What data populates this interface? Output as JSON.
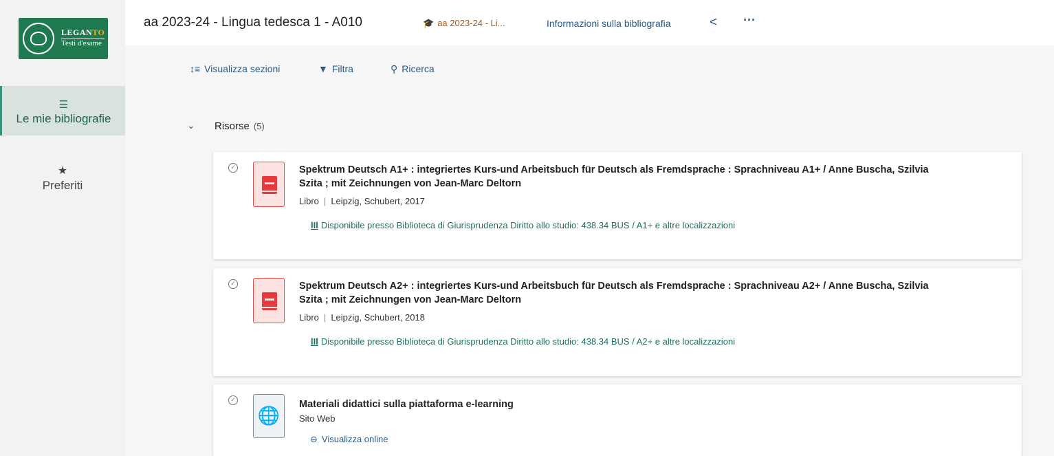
{
  "sidebar": {
    "logo_title_a": "LEGAN",
    "logo_title_b": "TO",
    "logo_subtitle": "Testi d'esame",
    "nav": [
      {
        "label": "Le mie bibliografie",
        "icon": "list-icon",
        "active": true
      },
      {
        "label": "Preferiti",
        "icon": "star-icon",
        "active": false
      }
    ]
  },
  "header": {
    "title": "aa 2023-24 - Lingua tedesca 1 - A010",
    "course": "aa 2023-24 - Li...",
    "info": "Informazioni sulla bibliografia",
    "share_icon": "share-icon",
    "more_icon": "more-icon"
  },
  "toolbar": {
    "sections_label": "Visualizza sezioni",
    "filter_label": "Filtra",
    "search_label": "Ricerca"
  },
  "section": {
    "label": "Risorse",
    "count": "(5)"
  },
  "items": [
    {
      "title": "Spektrum Deutsch A1+ : integriertes Kurs-und Arbeitsbuch für Deutsch als Fremdsprache : Sprachniveau A1+ / Anne Buscha, Szilvia Szita ; mit Zeichnungen von Jean-Marc Deltorn",
      "type": "Libro",
      "publication": "Leipzig, Schubert, 2017",
      "availability": "Disponibile presso Biblioteca di Giurisprudenza Diritto allo studio: 438.34 BUS / A1+ e altre localizzazioni"
    },
    {
      "title": "Spektrum Deutsch A2+ : integriertes Kurs-und Arbeitsbuch für Deutsch als Fremdsprache : Sprachniveau A2+ / Anne Buscha, Szilvia Szita ; mit Zeichnungen von Jean-Marc Deltorn",
      "type": "Libro",
      "publication": "Leipzig, Schubert, 2018",
      "availability": "Disponibile presso Biblioteca di Giurisprudenza Diritto allo studio: 438.34 BUS / A2+ e altre localizzazioni"
    },
    {
      "title": "Materiali didattici sulla piattaforma e-learning",
      "type": "Sito Web",
      "link": "Visualizza online"
    }
  ],
  "colors": {
    "brand_green": "#1e7a4e",
    "link_blue": "#2a5a86",
    "course_orange": "#b55410",
    "availability_teal": "#1f6f62",
    "book_red": "#e5393e"
  }
}
